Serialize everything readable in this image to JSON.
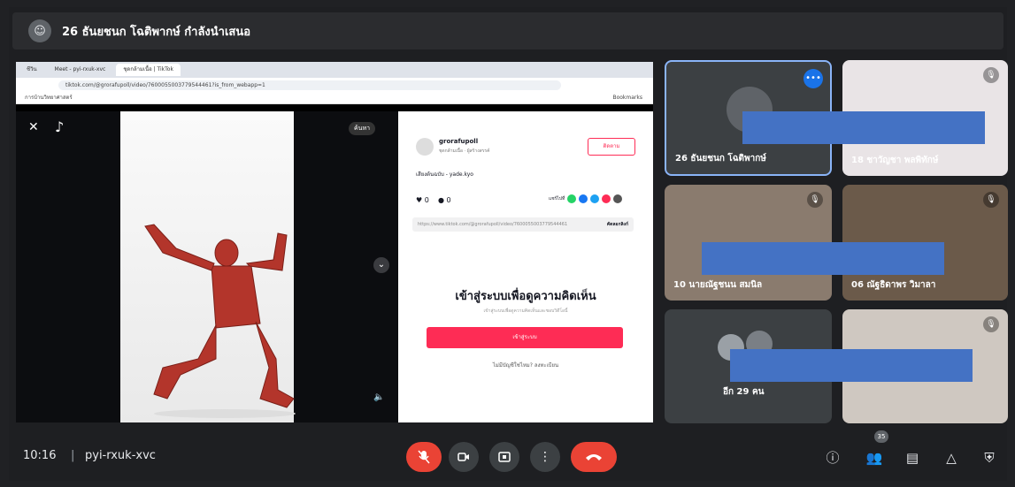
{
  "presenter": {
    "title": "26 ธันยชนก โฉติพากษ์ กำลังนำเสนอ"
  },
  "browser": {
    "tabs": [
      "ชีวิน",
      "Meet - pyi-rxuk-xvc",
      "ชุดกล้ามเนื้อ | TikTok"
    ],
    "url": "tiktok.com/@grorafupoll/video/7600055003779544461?is_from_webapp=1",
    "bookmark": "การบ้านวิทยาศาสตร์",
    "bookmarks_right": "Bookmarks"
  },
  "tiktok": {
    "search_label": "ค้นหา",
    "username": "grorafupoll",
    "subtitle": "ชุดกล้ามเนื้อ · ผู้สร้างสรรค์",
    "follow": "ติดตาม",
    "music": "เสียงต้นฉบับ - yade.kyo",
    "likes": "0",
    "comments": "0",
    "share_label": "แชร์ไปที่",
    "link": "https://www.tiktok.com/@grorafupoll/video/7600055003779544461",
    "copy_link": "คัดลอกลิงก์",
    "login_title": "เข้าสู่ระบบเพื่อดูความคิดเห็น",
    "login_sub": "เข้าสู่ระบบเพื่อดูความคิดเห็นและชอบวิดีโอนี้",
    "login_button": "เข้าสู่ระบบ",
    "register": "ไม่มีบัญชีใช่ไหม? ลงทะเบียน"
  },
  "participants": [
    {
      "name": "26 ธันยชนก โฉติพากษ์"
    },
    {
      "name": "18 ชาวัญชา พลพิทักษ์"
    },
    {
      "name": "10 นายณัฐชนน สมนิล"
    },
    {
      "name": "06 ณัฐธิดาพร วิมาลา"
    },
    {
      "name": "อีก 29 คน"
    }
  ],
  "meeting": {
    "time": "10:16",
    "separator": "|",
    "code": "pyi-rxuk-xvc",
    "participant_count": "35"
  },
  "colors": {
    "accent": "#1a73e8",
    "end_call": "#ea4335",
    "redaction": "#4472c4"
  }
}
